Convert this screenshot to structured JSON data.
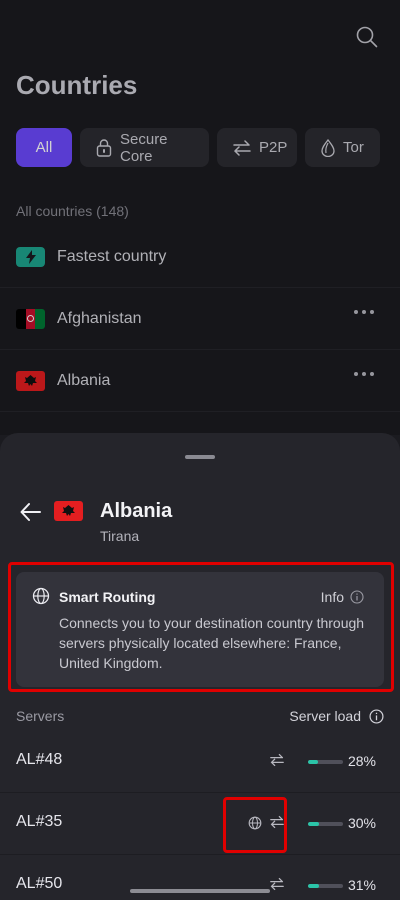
{
  "page": {
    "title": "Countries"
  },
  "filters": [
    {
      "label": "All",
      "icon": "all",
      "active": true
    },
    {
      "label": "Secure Core",
      "icon": "lock-icon",
      "active": false
    },
    {
      "label": "P2P",
      "icon": "p2p-arrows-icon",
      "active": false
    },
    {
      "label": "Tor",
      "icon": "onion-icon",
      "active": false
    }
  ],
  "list": {
    "count_label": "All countries (148)",
    "items": [
      {
        "name": "Fastest country",
        "icon": "bolt-icon"
      },
      {
        "name": "Afghanistan",
        "icon": "flag-afghanistan"
      },
      {
        "name": "Albania",
        "icon": "flag-albania"
      }
    ]
  },
  "sheet": {
    "country": "Albania",
    "city": "Tirana",
    "routing": {
      "title": "Smart Routing",
      "info_label": "Info",
      "description": "Connects you to your destination country through servers physically located elsewhere: France, United Kingdom."
    },
    "servers_label": "Servers",
    "load_label": "Server load",
    "servers": [
      {
        "name": "AL#48",
        "load": "28%",
        "load_fraction": 0.28,
        "smart_routing": false
      },
      {
        "name": "AL#35",
        "load": "30%",
        "load_fraction": 0.3,
        "smart_routing": true
      },
      {
        "name": "AL#50",
        "load": "31%",
        "load_fraction": 0.31,
        "smart_routing": false
      }
    ]
  },
  "colors": {
    "accent": "#6d4aff",
    "load": "#2bc4a8",
    "highlight": "#e00000",
    "fastest": "#1ea58f"
  }
}
